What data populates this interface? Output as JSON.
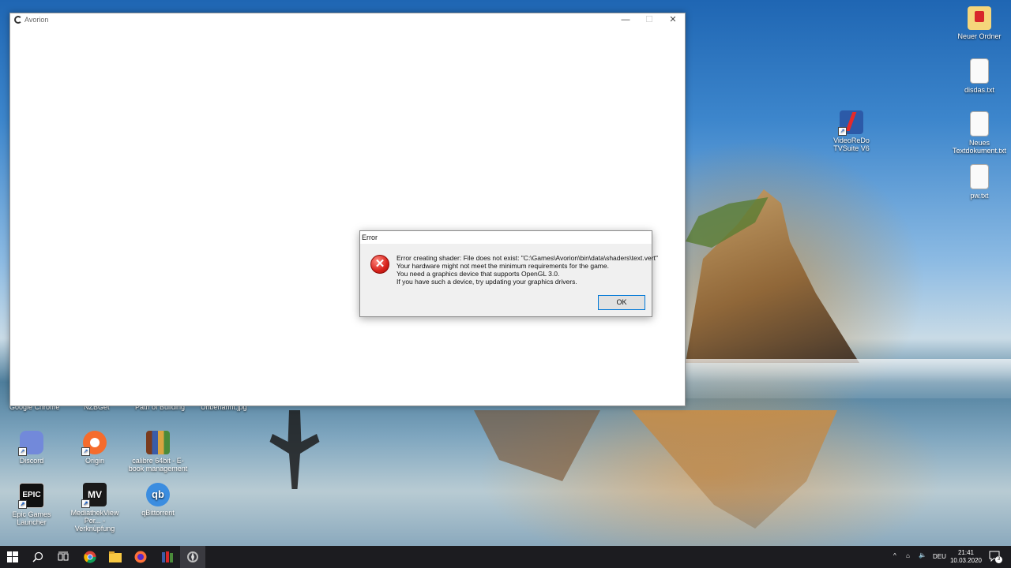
{
  "desktop": {
    "right_icons": [
      {
        "label": "Neuer Ordner"
      },
      {
        "label": "disdas.txt"
      },
      {
        "label": "VideoReDo TVSuite V6"
      },
      {
        "label": "Neues Textdokument.txt"
      },
      {
        "label": "pw.txt"
      }
    ],
    "clipped_labels": [
      "Google Chrome",
      "NZBGet",
      "Path of Building",
      "Unbenannt.jpg"
    ],
    "bottom_icons": [
      {
        "label": "Discord"
      },
      {
        "label": "Origin"
      },
      {
        "label": "calibre 64bit - E-book management"
      },
      {
        "label": "Epic Games Launcher"
      },
      {
        "label": "MediathekView Por... - Verknüpfung"
      },
      {
        "label": "qBittorrent"
      }
    ]
  },
  "app_window": {
    "title": "Avorion",
    "controls": [
      "—",
      "☐",
      "✕"
    ]
  },
  "dialog": {
    "title": "Error",
    "message_lines": [
      "Error creating shader: File does not exist: \"C:\\Games\\Avorion\\bin\\data\\shaders\\text.vert\"",
      "Your hardware might not meet the minimum requirements for the game.",
      "You need a graphics device that supports OpenGL 3.0.",
      "If you have such a device, try updating your graphics drivers."
    ],
    "ok_label": "OK"
  },
  "taskbar": {
    "language": "DEU",
    "time": "21:41",
    "date": "10.03.2020",
    "notification_count": "3"
  }
}
